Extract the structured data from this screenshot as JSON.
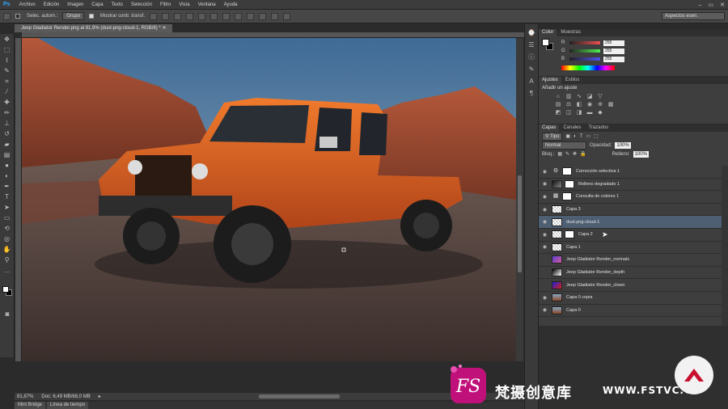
{
  "app": {
    "logo": "Ps"
  },
  "menu": [
    "Archivo",
    "Edición",
    "Imagen",
    "Capa",
    "Texto",
    "Selección",
    "Filtro",
    "Vista",
    "Ventana",
    "Ayuda"
  ],
  "options": {
    "auto_select_label": "Selec. autom.:",
    "auto_select_value": "Grupo",
    "transform_label": "Mostrar contr. transf.",
    "workspace": "Aspectos esen."
  },
  "document": {
    "tab_title": "Jeep Gladiator Render.png al 81,9% (dust-png-cloud-1, RGB/8) *"
  },
  "status": {
    "zoom": "81,87%",
    "doc_size": "Doc: 6,49 MB/68,0 MB"
  },
  "bottom_tabs": [
    "Mini Bridge",
    "Línea de tiempo"
  ],
  "color_panel": {
    "tabs": [
      "Color",
      "Muestras"
    ],
    "rows": [
      {
        "label": "R",
        "value": "255",
        "gradient": "#f05050"
      },
      {
        "label": "G",
        "value": "255",
        "gradient": "#50f050"
      },
      {
        "label": "B",
        "value": "255",
        "gradient": "#5050f0"
      }
    ]
  },
  "adjust_panel": {
    "tabs": [
      "Ajustes",
      "Estilos"
    ],
    "title": "Añadir un ajuste"
  },
  "layers_panel": {
    "tabs": [
      "Capas",
      "Canales",
      "Trazados"
    ],
    "filter": "Tipo",
    "blend_mode": "Normal",
    "opacity_label": "Opacidad:",
    "opacity_value": "100%",
    "lock_label": "Bloq.:",
    "fill_label": "Relleno:",
    "fill_value": "100%",
    "layers": [
      {
        "name": "Corrección selectiva 1",
        "kind": "adjustment",
        "icon": "⚙"
      },
      {
        "name": "Relleno degradado 1",
        "kind": "gradient"
      },
      {
        "name": "Consulta de colores 1",
        "kind": "adjustment",
        "icon": "▦"
      },
      {
        "name": "Capa 3",
        "kind": "transparent"
      },
      {
        "name": "dust-png-cloud-1",
        "kind": "transparent",
        "selected": true
      },
      {
        "name": "Capa 2",
        "kind": "masked"
      },
      {
        "name": "Capa 1",
        "kind": "transparent"
      },
      {
        "name": "Jeep Gladiator Render_normals",
        "kind": "render-normals"
      },
      {
        "name": "Jeep Gladiator Render_depth",
        "kind": "render-depth"
      },
      {
        "name": "Jeep Gladiator Render_clown",
        "kind": "render-clown"
      },
      {
        "name": "Capa 0 copia",
        "kind": "photo"
      },
      {
        "name": "Capa 0",
        "kind": "photo"
      }
    ]
  },
  "watermark": {
    "logo_text": "FS",
    "brand": "梵摄创意库",
    "url": "WWW.FSTVC.CC"
  }
}
